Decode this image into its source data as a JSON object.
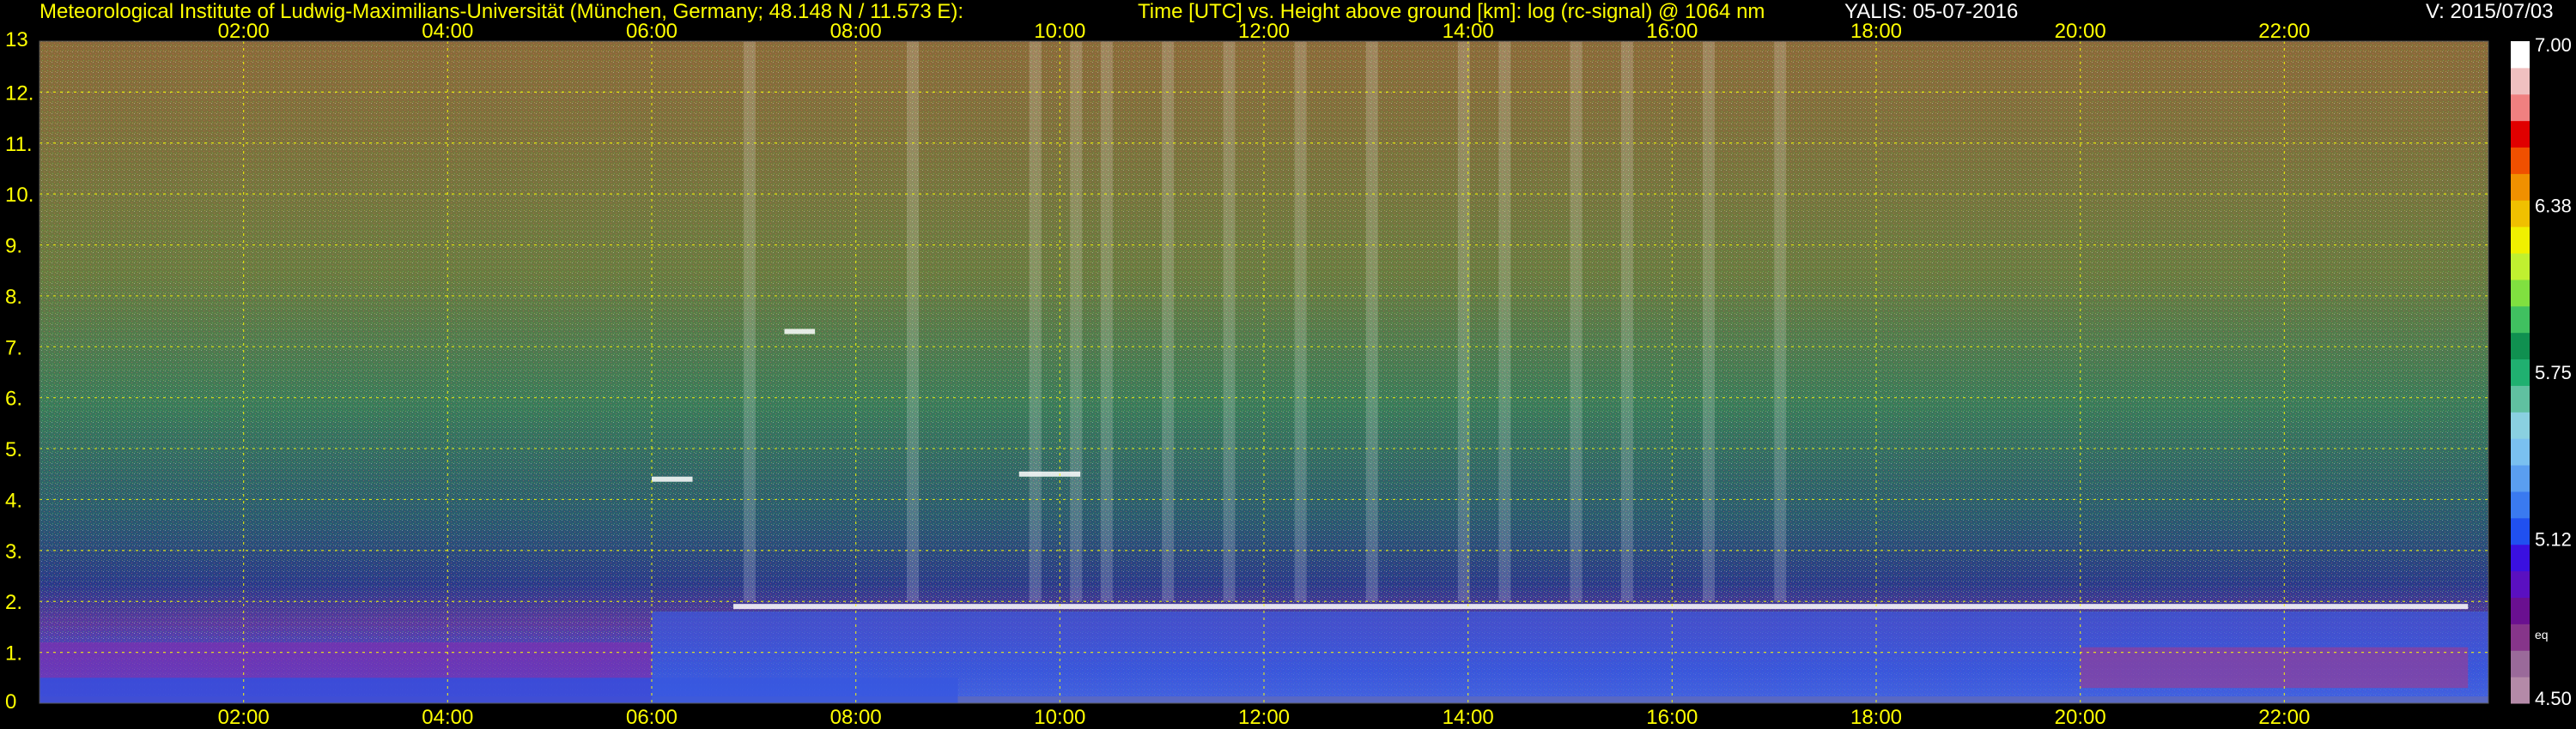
{
  "header": {
    "institute": "Meteorological Institute of Ludwig-Maximilians-Universität (München, Germany; 48.148 N / 11.573 E):",
    "axes_desc": "Time [UTC] vs. Height above ground [km]: log (rc-signal) @ 1064 nm",
    "instrument_date": "YALIS: 05-07-2016",
    "version": "V: 2015/07/03"
  },
  "colors": {
    "background": "#000000",
    "text": "#ffff00",
    "grid": "#ffff00",
    "colorbar_label": "#ffffff"
  },
  "chart_data": {
    "type": "heatmap",
    "title": "Time [UTC] vs. Height above ground [km]: log (rc-signal) @ 1064 nm",
    "xlabel": "Time [UTC]",
    "ylabel": "Height above ground [km]",
    "x_ticks": [
      "02:00",
      "04:00",
      "06:00",
      "08:00",
      "10:00",
      "12:00",
      "14:00",
      "16:00",
      "18:00",
      "20:00",
      "22:00"
    ],
    "x_tick_hours": [
      2,
      4,
      6,
      8,
      10,
      12,
      14,
      16,
      18,
      20,
      22
    ],
    "xlim_hours": [
      0,
      24
    ],
    "y_ticks": [
      "0",
      "1.",
      "2.",
      "3.",
      "4.",
      "5.",
      "6.",
      "7.",
      "8.",
      "9.",
      "10.",
      "11.",
      "12.",
      "13"
    ],
    "y_tick_values": [
      0,
      1,
      2,
      3,
      4,
      5,
      6,
      7,
      8,
      9,
      10,
      11,
      12,
      13
    ],
    "ylim_km": [
      0,
      13
    ],
    "grid": true,
    "colorbar": {
      "min": 4.5,
      "max": 7.0,
      "labels": [
        "7.00",
        "6.38",
        "5.75",
        "5.12",
        "4.50"
      ],
      "label_values": [
        7.0,
        6.38,
        5.75,
        5.12,
        4.5
      ],
      "extra_label": "eq",
      "colors": [
        "#b48aa8",
        "#9a6a9a",
        "#86358a",
        "#6a1090",
        "#5a10c0",
        "#3a10e0",
        "#2050f0",
        "#3a7af0",
        "#5a9ef0",
        "#7ac0f0",
        "#8ad0e0",
        "#60c0a0",
        "#20b070",
        "#109050",
        "#40c060",
        "#80e040",
        "#c0f030",
        "#f0f000",
        "#f0c000",
        "#f09000",
        "#f05000",
        "#e00000",
        "#f08080",
        "#f0c0c0",
        "#ffffff"
      ]
    },
    "cloud_layers_km": [
      {
        "start_hour": 6.0,
        "end_hour": 6.4,
        "height": 4.4
      },
      {
        "start_hour": 9.6,
        "end_hour": 10.2,
        "height": 4.5
      },
      {
        "start_hour": 7.3,
        "end_hour": 7.6,
        "height": 7.3
      },
      {
        "start_hour": 6.8,
        "end_hour": 23.8,
        "height": 1.9
      }
    ]
  }
}
